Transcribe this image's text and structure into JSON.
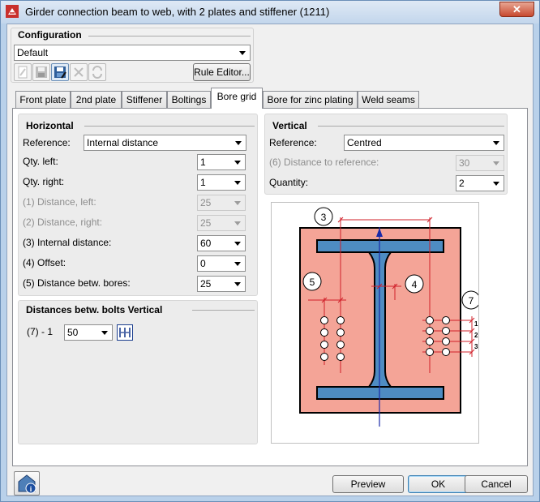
{
  "window": {
    "title": "Girder connection beam to web, with 2 plates and stiffener (1211)",
    "close_label": "✕"
  },
  "configuration": {
    "title": "Configuration",
    "selected": "Default",
    "rule_editor_label": "Rule Editor..."
  },
  "tabs": [
    "Front plate",
    "2nd plate",
    "Stiffener",
    "Boltings",
    "Bore grid",
    "Bore for zinc plating",
    "Weld seams"
  ],
  "active_tab": "Bore grid",
  "horizontal": {
    "title": "Horizontal",
    "reference_label": "Reference:",
    "reference_value": "Internal distance",
    "rows": [
      {
        "label": "Qty. left:",
        "value": "1",
        "enabled": true
      },
      {
        "label": "Qty. right:",
        "value": "1",
        "enabled": true
      },
      {
        "label": "(1) Distance, left:",
        "value": "25",
        "enabled": false
      },
      {
        "label": "(2) Distance, right:",
        "value": "25",
        "enabled": false
      },
      {
        "label": "(3) Internal distance:",
        "value": "60",
        "enabled": true
      },
      {
        "label": "(4) Offset:",
        "value": "0",
        "enabled": true
      },
      {
        "label": "(5) Distance betw. bores:",
        "value": "25",
        "enabled": true
      }
    ]
  },
  "vertical": {
    "title": "Vertical",
    "reference_label": "Reference:",
    "reference_value": "Centred",
    "distance_label": "(6) Distance to reference:",
    "distance_value": "30",
    "quantity_label": "Quantity:",
    "quantity_value": "2"
  },
  "distances_vertical": {
    "title": "Distances betw. bolts Vertical",
    "row_label": "(7) - 1",
    "row_value": "50"
  },
  "diagram": {
    "labels": [
      "3",
      "4",
      "5",
      "7",
      "1",
      "2",
      "3"
    ],
    "plate_color": "#f4a497",
    "steel_color": "#4e8cc2",
    "dim_color": "#d0202a",
    "axis_color": "#1a2aa8"
  },
  "footer": {
    "preview": "Preview",
    "ok": "OK",
    "cancel": "Cancel"
  }
}
